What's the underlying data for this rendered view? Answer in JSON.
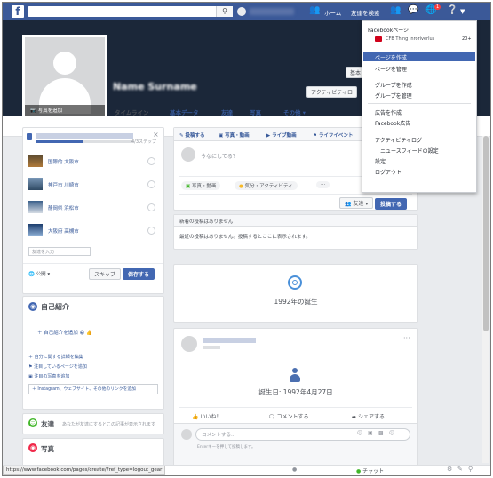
{
  "topbar": {
    "logo": "f",
    "home": "ホーム",
    "find_friends": "友達を検索",
    "notif_count": "1"
  },
  "cover": {
    "update_photo": "写真を追加",
    "edit_profile": "基本",
    "activity_log": "アクティビティロ"
  },
  "tabs": [
    "タイムライン",
    "基本データ",
    "友達",
    "写真",
    "その他"
  ],
  "dropdown": {
    "header": "Facebookページ",
    "page_name": "CFB Thing Inroriverlus",
    "page_count": "20+",
    "items": [
      "ページを作成",
      "ページを管理",
      "グループを作成",
      "グループを管理",
      "広告を作成",
      "Facebook広告",
      "アクティビティログ",
      "ニュースフィードの設定",
      "設定",
      "ログアウト"
    ]
  },
  "people_card": {
    "progress": "4/3ステップ",
    "people": [
      {
        "name": "国際的 大阪市"
      },
      {
        "name": "神戸市 川崎市"
      },
      {
        "name": "静岡県 浜松市"
      },
      {
        "name": "大阪府 高槻市"
      }
    ],
    "input_placeholder": "友達を入力",
    "privacy": "公開",
    "skip": "スキップ",
    "save": "保存する"
  },
  "intro": {
    "title": "自己紹介",
    "add_bio": "＋ 自己紹介を追加 😀 👍",
    "link1": "自分に関する詳細を編集",
    "link2": "注目しているページを追加",
    "link3": "注目の写真を追加",
    "instagram": "＋ Instagram、ウェブサイト、その他のリンクを追加"
  },
  "friends": {
    "title": "友達",
    "text": "あなたが友達にするとこの記事が表示されます"
  },
  "photos": {
    "title": "写真"
  },
  "composer": {
    "tabs": [
      "投稿する",
      "写真・動画",
      "ライブ動画",
      "ライフイベント"
    ],
    "placeholder": "今なにしてる？",
    "photo_video": "写真・動画",
    "feeling": "気分・アクティビティ",
    "more": "···",
    "audience": "友達",
    "post": "投稿する"
  },
  "notice": {
    "title": "新着の投稿はありません",
    "text": "最近の投稿はありません。投稿するとここに表示されます。"
  },
  "born": {
    "year_text": "1992年の誕生"
  },
  "birth_post": {
    "text": "誕生日: 1992年4月27日",
    "like": "いいね！",
    "comment": "コメントする",
    "share": "シェアする",
    "comment_placeholder": "コメントする...",
    "hint": "Enterキーを押して投稿します。"
  },
  "statusbar": {
    "url": "https://www.facebook.com/pages/create/?ref_type=logout_gear",
    "chat": "チャット"
  }
}
